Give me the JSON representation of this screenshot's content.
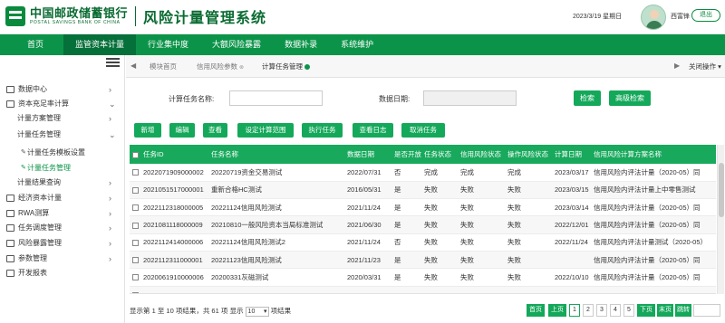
{
  "header": {
    "logo_cn": "中国邮政储蓄银行",
    "logo_en": "POSTAL SAVINGS BANK OF CHINA",
    "system_title": "风险计量管理系统",
    "date": "2023/3/19 星期日",
    "username": "西富锋",
    "logout": "退出"
  },
  "nav": [
    "首页",
    "监管资本计量",
    "行业集中度",
    "大额风险暴露",
    "数据补录",
    "系统维护"
  ],
  "sidebar": {
    "items": [
      {
        "label": "数据中心",
        "arrow": "›"
      },
      {
        "label": "资本充足率计算",
        "arrow": "⌄"
      },
      {
        "label": "计量方案管理",
        "arrow": "›"
      },
      {
        "label": "计量任务管理",
        "arrow": "⌄"
      },
      {
        "label": "计量任务模板设置",
        "arrow": ""
      },
      {
        "label": "计量任务管理",
        "arrow": ""
      },
      {
        "label": "计量结果查询",
        "arrow": "›"
      },
      {
        "label": "经济资本计量",
        "arrow": "›"
      },
      {
        "label": "RWA测算",
        "arrow": "›"
      },
      {
        "label": "任务调度管理",
        "arrow": "›"
      },
      {
        "label": "风险暴露管理",
        "arrow": "›"
      },
      {
        "label": "参数管理",
        "arrow": "›"
      },
      {
        "label": "开发报表",
        "arrow": ""
      }
    ]
  },
  "tabs": {
    "items": [
      "模块首页",
      "信用风险参数",
      "计算任务管理"
    ],
    "close_ops": "关闭操作"
  },
  "filter": {
    "task_name_label": "计算任务名称:",
    "data_date_label": "数据日期:",
    "search": "检索",
    "advanced_search": "高级检索"
  },
  "toolbar": [
    "新增",
    "编辑",
    "查看",
    "设定计算范围",
    "执行任务",
    "查看日志",
    "取消任务"
  ],
  "table": {
    "headers": [
      "",
      "任务ID",
      "任务名称",
      "数据日期",
      "是否开放",
      "任务状态",
      "信用风险状态",
      "操作风险状态",
      "计算日期",
      "信用风险计算方案名称"
    ],
    "rows": [
      [
        "",
        "2022071909000002",
        "20220719资金交易测试",
        "2022/07/31",
        "否",
        "完成",
        "完成",
        "完成",
        "2023/03/17",
        "信用风险内评法计量（2020-05）同"
      ],
      [
        "",
        "2021051517000001",
        "重新合格HC测试",
        "2016/05/31",
        "是",
        "失败",
        "失败",
        "失败",
        "2023/03/15",
        "信用风险内评法计量上中零售测试"
      ],
      [
        "",
        "2022112318000005",
        "20221124信用风险测试",
        "2021/11/24",
        "是",
        "失败",
        "失败",
        "失败",
        "2023/03/14",
        "信用风险内评法计量（2020-05）同"
      ],
      [
        "",
        "2021081118000009",
        "20210810一般风险资本当局标准测试",
        "2021/06/30",
        "是",
        "失败",
        "失败",
        "失败",
        "2022/12/01",
        "信用风险内评法计量（2020-05）同"
      ],
      [
        "",
        "2022112414000006",
        "20221124信用风险测试2",
        "2021/11/24",
        "否",
        "失败",
        "失败",
        "失败",
        "2022/11/24",
        "信用风险内评法计量测试（2020-05）"
      ],
      [
        "",
        "2022112311000001",
        "20221123信用风险测试",
        "2021/11/23",
        "是",
        "失败",
        "失败",
        "失败",
        "",
        "信用风险内评法计量（2020-05）同"
      ],
      [
        "",
        "2020061910000006",
        "20200331灰磁测试",
        "2020/03/31",
        "是",
        "失败",
        "失败",
        "失败",
        "2022/10/10",
        "信用风险内评法计量（2020-05）同"
      ],
      [
        "",
        "",
        "",
        "",
        "",
        "",
        "",
        "",
        "",
        ""
      ]
    ]
  },
  "footer": {
    "summary_prefix": "显示第 1 至 10 项结果，共 61 项  显示",
    "page_size": "10",
    "summary_suffix": "项结果",
    "first": "首页",
    "prev": "上页",
    "pages": [
      "1",
      "2",
      "3",
      "4",
      "5"
    ],
    "next": "下页",
    "last": "末页",
    "jump": "跳转"
  },
  "colors": {
    "brand_green": "#0b9449",
    "button_green": "#14a85a",
    "header_text": "#0a6b32"
  }
}
